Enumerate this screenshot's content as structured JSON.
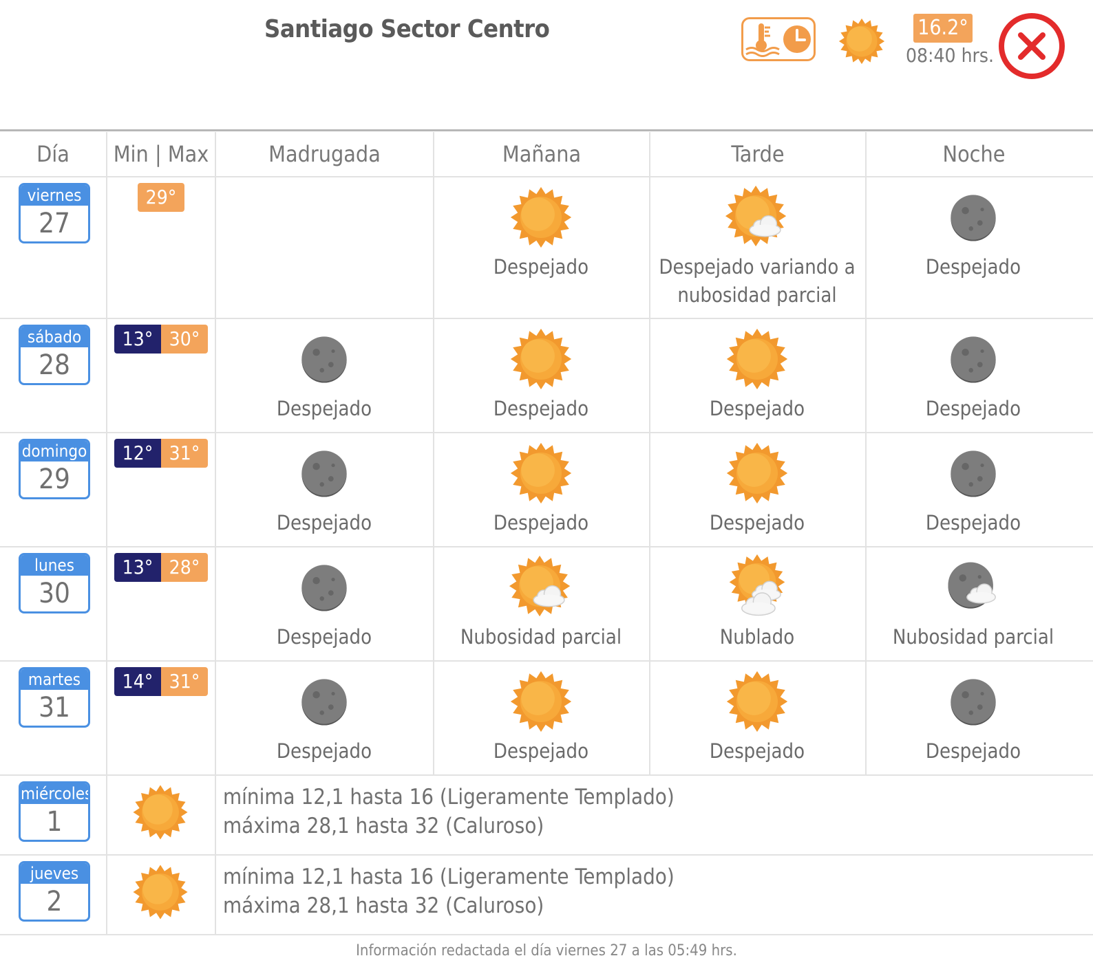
{
  "header": {
    "title": "Santiago Sector Centro",
    "current_temp": "16.2°",
    "current_time": "08:40 hrs.",
    "current_icon": "sun-icon",
    "sensor_icon": "thermometer-clock-icon",
    "close_icon": "close-icon"
  },
  "table": {
    "headers": [
      "Día",
      "Min | Max",
      "Madrugada",
      "Mañana",
      "Tarde",
      "Noche"
    ]
  },
  "days": [
    {
      "name": "viernes",
      "num": "27",
      "min": "",
      "max": "29°",
      "periods": [
        null,
        {
          "icon": "sun",
          "label": "Despejado"
        },
        {
          "icon": "sun-cloud",
          "label": "Despejado variando a nubosidad parcial"
        },
        {
          "icon": "moon",
          "label": "Despejado"
        }
      ]
    },
    {
      "name": "sábado",
      "num": "28",
      "min": "13°",
      "max": "30°",
      "periods": [
        {
          "icon": "moon",
          "label": "Despejado"
        },
        {
          "icon": "sun",
          "label": "Despejado"
        },
        {
          "icon": "sun",
          "label": "Despejado"
        },
        {
          "icon": "moon",
          "label": "Despejado"
        }
      ]
    },
    {
      "name": "domingo",
      "num": "29",
      "min": "12°",
      "max": "31°",
      "periods": [
        {
          "icon": "moon",
          "label": "Despejado"
        },
        {
          "icon": "sun",
          "label": "Despejado"
        },
        {
          "icon": "sun",
          "label": "Despejado"
        },
        {
          "icon": "moon",
          "label": "Despejado"
        }
      ]
    },
    {
      "name": "lunes",
      "num": "30",
      "min": "13°",
      "max": "28°",
      "periods": [
        {
          "icon": "moon",
          "label": "Despejado"
        },
        {
          "icon": "sun-cloud",
          "label": "Nubosidad parcial"
        },
        {
          "icon": "sun-clouds",
          "label": "Nublado"
        },
        {
          "icon": "moon-cloud",
          "label": "Nubosidad parcial"
        }
      ]
    },
    {
      "name": "martes",
      "num": "31",
      "min": "14°",
      "max": "31°",
      "periods": [
        {
          "icon": "moon",
          "label": "Despejado"
        },
        {
          "icon": "sun",
          "label": "Despejado"
        },
        {
          "icon": "sun",
          "label": "Despejado"
        },
        {
          "icon": "moon",
          "label": "Despejado"
        }
      ]
    }
  ],
  "extended": [
    {
      "name": "miércoles",
      "num": "1",
      "icon": "sun",
      "line1": "mínima 12,1 hasta 16 (Ligeramente Templado)",
      "line2": "máxima 28,1 hasta 32 (Caluroso)"
    },
    {
      "name": "jueves",
      "num": "2",
      "icon": "sun",
      "line1": "mínima 12,1 hasta 16 (Ligeramente Templado)",
      "line2": "máxima 28,1 hasta 32 (Caluroso)"
    }
  ],
  "footer": "Información redactada el día viernes 27 a las 05:49 hrs.",
  "colors": {
    "accent_orange": "#f3a45b",
    "min_blue": "#22226b",
    "calendar_blue": "#4a90e2",
    "close_red": "#e32b2b"
  }
}
